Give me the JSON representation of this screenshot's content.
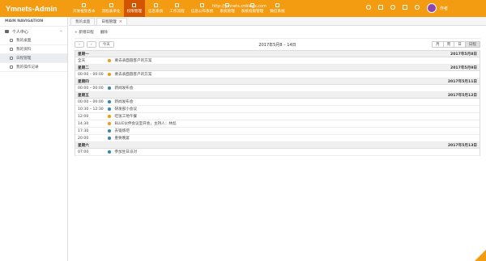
{
  "app": {
    "logo": "Ymnets-Admin",
    "url": "http://ymnets.cnblogs.com",
    "user_name": "作者"
  },
  "nav_modules": [
    "开发框架各本",
    "流程表单化",
    "权限管理",
    "信息系统",
    "工作流程",
    "信息公布系统",
    "系统管理",
    "系统权限管理",
    "微信系统"
  ],
  "sidebar": {
    "title": "MAIN NAVIGATION",
    "group": {
      "label": "个人中心",
      "chevron": "«"
    },
    "items": [
      {
        "label": "我的桌面"
      },
      {
        "label": "我的资料"
      },
      {
        "label": "日程管理"
      },
      {
        "label": "我的操作记录"
      }
    ]
  },
  "tabs": [
    {
      "label": "我的桌面"
    },
    {
      "label": "日程管理",
      "close": "×"
    }
  ],
  "toolbar": {
    "add_label": "+ 新增日程",
    "delete_label": "删除"
  },
  "calendar": {
    "prev": "‹",
    "next": "›",
    "today": "今天",
    "period": "2017年5月8 – 14日",
    "views": [
      "月",
      "周",
      "日",
      "日程"
    ],
    "days": [
      {
        "weekday": "星期一",
        "date": "2017年5月8日",
        "events": [
          {
            "time": "全天",
            "title": "要去表面圆客户的方案",
            "color": "orange"
          }
        ]
      },
      {
        "weekday": "星期二",
        "date": "2017年5月9日",
        "events": [
          {
            "time": "00:00 – 00:00",
            "title": "要去表面圆客户的方案",
            "color": "orange"
          }
        ]
      },
      {
        "weekday": "星期四",
        "date": "2017年5月11日",
        "events": [
          {
            "time": "00:00 – 00:00",
            "title": "新闻发布会",
            "color": "blue"
          }
        ]
      },
      {
        "weekday": "星期五",
        "date": "2017年5月12日",
        "events": [
          {
            "time": "00:00 – 00:00",
            "title": "新闻发布会",
            "color": "blue"
          },
          {
            "time": "10:30 – 12:30",
            "title": "研发部小会议",
            "color": "blue"
          },
          {
            "time": "12:00",
            "title": "吃饭工地午餐",
            "color": "orange"
          },
          {
            "time": "14:30",
            "title": "BLUE伙伴会议室开会，主持人：林彪",
            "color": "orange"
          },
          {
            "time": "17:30",
            "title": "去锻炼吧",
            "color": "blue"
          },
          {
            "time": "20:00",
            "title": "重要晚宴",
            "color": "blue"
          }
        ]
      },
      {
        "weekday": "星期六",
        "date": "2017年5月13日",
        "events": [
          {
            "time": "07:00",
            "title": "参加生日派对",
            "color": "blue"
          }
        ]
      }
    ]
  },
  "colors": {
    "accent": "#f39c12",
    "active_nav": "#d35400",
    "event_orange": "#f39c12",
    "event_blue": "#3a87ad"
  }
}
